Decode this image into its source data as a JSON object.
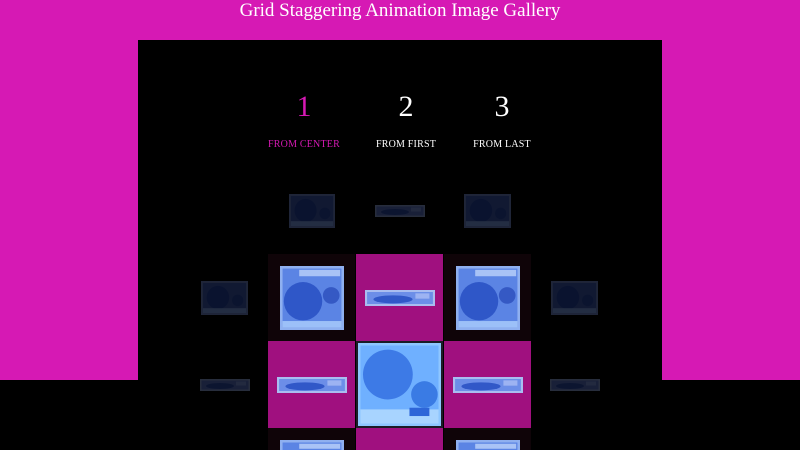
{
  "page": {
    "title": "Grid Staggering Animation Image Gallery"
  },
  "controls": [
    {
      "number": "1",
      "label": "FROM CENTER",
      "active": true
    },
    {
      "number": "2",
      "label": "FROM FIRST",
      "active": false
    },
    {
      "number": "3",
      "label": "FROM LAST",
      "active": false
    }
  ],
  "colors": {
    "accent": "#d619b4",
    "cell_highlight": "#a0107f",
    "panel": "#000000",
    "image_blue": "#4c6cf0"
  },
  "gallery": {
    "image_icon": "gallery-image-icon"
  }
}
